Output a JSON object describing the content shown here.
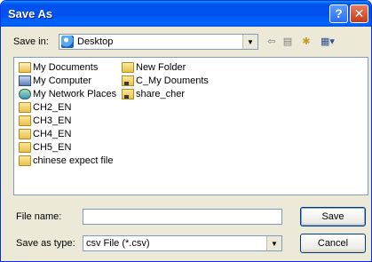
{
  "window": {
    "title": "Save As"
  },
  "titlebar": {
    "help_label": "?",
    "close_label": "✕"
  },
  "savein": {
    "label": "Save in:",
    "value": "Desktop",
    "icon": "desktop-icon"
  },
  "toolbar": {
    "back_icon": "back-arrow-icon",
    "up_icon": "up-folder-icon",
    "newfolder_icon": "new-folder-icon",
    "views_icon": "views-menu-icon"
  },
  "files": [
    {
      "name": "My Documents",
      "icon": "my-documents-icon"
    },
    {
      "name": "My Computer",
      "icon": "my-computer-icon"
    },
    {
      "name": "My Network Places",
      "icon": "network-places-icon"
    },
    {
      "name": "CH2_EN",
      "icon": "folder-icon"
    },
    {
      "name": "CH3_EN",
      "icon": "folder-icon"
    },
    {
      "name": "CH4_EN",
      "icon": "folder-icon"
    },
    {
      "name": "CH5_EN",
      "icon": "folder-icon"
    },
    {
      "name": "chinese expect file",
      "icon": "folder-icon"
    },
    {
      "name": "New Folder",
      "icon": "folder-icon"
    },
    {
      "name": "C_My Douments",
      "icon": "shared-folder-icon"
    },
    {
      "name": "share_cher",
      "icon": "shared-folder-icon"
    }
  ],
  "filename": {
    "label": "File name:",
    "value": ""
  },
  "savetype": {
    "label": "Save as type:",
    "value": "csv File (*.csv)"
  },
  "buttons": {
    "save": "Save",
    "cancel": "Cancel"
  },
  "colors": {
    "titlebar": "#0054E3",
    "dialog_bg": "#ECE9D8",
    "border": "#7F9DB9"
  }
}
